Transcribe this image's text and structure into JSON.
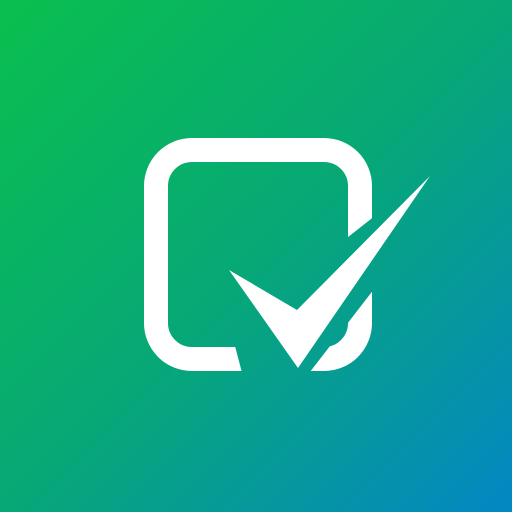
{
  "app_icon": {
    "icon": "checkbox-checked-icon",
    "colors": {
      "gradient_start": "#0ABF4E",
      "gradient_mid": "#07A876",
      "gradient_end": "#0487C4",
      "glyph": "#FFFFFF"
    }
  }
}
